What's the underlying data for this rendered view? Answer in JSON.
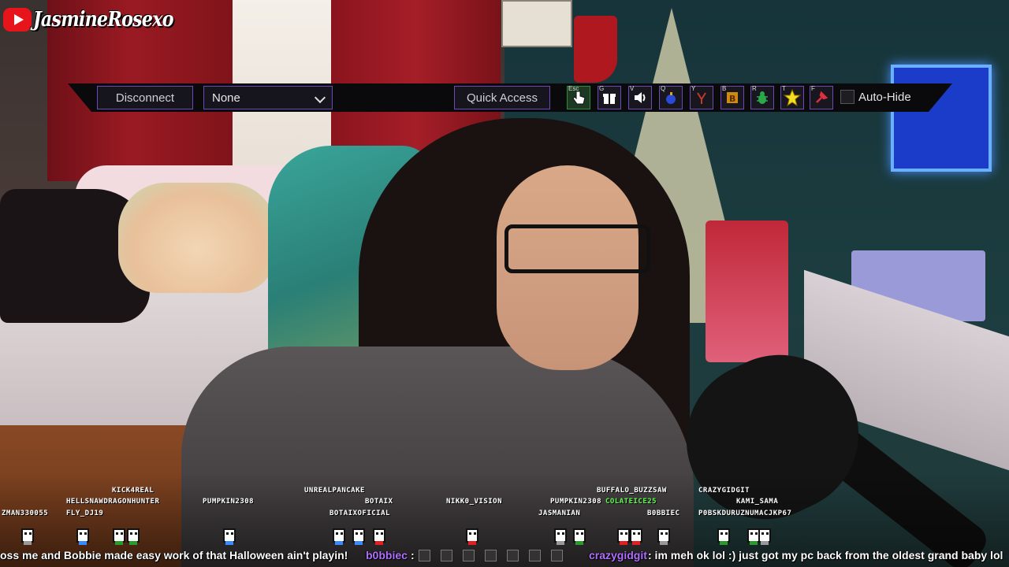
{
  "watermark": {
    "channel": "JasmineRosexo"
  },
  "toolbar": {
    "disconnect_label": "Disconnect",
    "select_value": "None",
    "quick_access_label": "Quick Access",
    "tools": [
      {
        "key": "Esc",
        "icon": "hand-cursor-icon"
      },
      {
        "key": "G",
        "icon": "gift-icon"
      },
      {
        "key": "V",
        "icon": "speaker-icon"
      },
      {
        "key": "Q",
        "icon": "bomb-icon"
      },
      {
        "key": "Y",
        "icon": "claw-icon"
      },
      {
        "key": "B",
        "icon": "b-block-icon"
      },
      {
        "key": "R",
        "icon": "bug-icon"
      },
      {
        "key": "T",
        "icon": "star-icon"
      },
      {
        "key": "F",
        "icon": "pin-icon"
      }
    ],
    "autohide_label": "Auto-Hide",
    "accent": "#6c4bb8"
  },
  "viewers": [
    "KICK4REAL",
    "HELLSNAWDRAGONHUNTER",
    "ZMAN330055",
    "FLY_DJ19",
    "PUMPKIN2308",
    "UNREALPANCAKE",
    "BOTAIX",
    "BOTAIXOFICIAL",
    "NIKK0_VISION",
    "PUMPKIN2308",
    "COLATEICE25",
    "JASMANIAN",
    "BUFFALO_BUZZSAW",
    "B0BBIEC",
    "CRAZYGIDGIT",
    "KAMI_SAMA",
    "P0BSKDURUZNUMACJKP67"
  ],
  "chat": {
    "msg1": "oss me and Bobbie made easy work of that Halloween ain't playin!",
    "user2": "b0bbiec",
    "sep": ":",
    "user3": "crazygidgit",
    "msg3": ": im meh ok lol :) just got my pc back from the oldest grand baby lol"
  }
}
